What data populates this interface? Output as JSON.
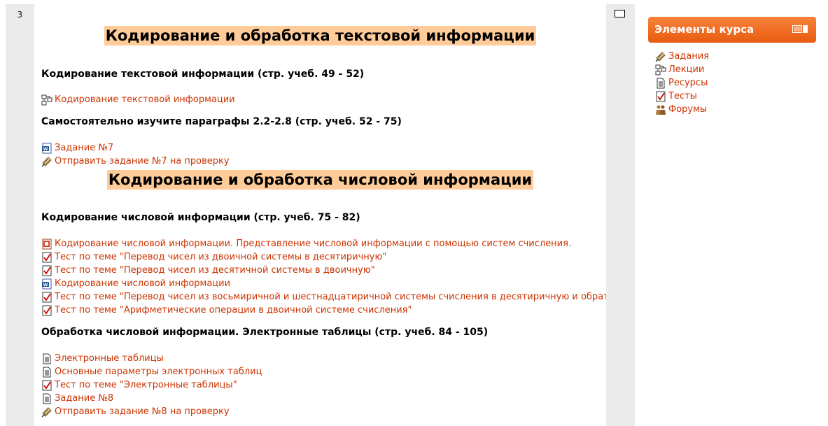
{
  "section": {
    "number": "3"
  },
  "headings": [
    "Кодирование и обработка текстовой информации",
    "Кодирование и обработка числовой информации"
  ],
  "subheads": [
    "Кодирование текстовой информации (стр. учеб. 49 - 52)",
    "Самостоятельно изучите параграфы 2.2-2.8 (стр. учеб. 52 - 75)",
    "Кодирование числовой информации (стр. учеб. 75 - 82)",
    "Обработка числовой информации. Электронные таблицы (стр. учеб. 84 - 105)"
  ],
  "items": [
    {
      "icon": "lesson-icon",
      "label": "Кодирование текстовой информации"
    },
    {
      "icon": "word-doc-icon",
      "label": "Задание №7"
    },
    {
      "icon": "assignment-icon",
      "label": "Отправить задание №7 на проверку"
    },
    {
      "icon": "presentation-icon",
      "label": "Кодирование числовой информации. Представление числовой информации с помощью систем счисления."
    },
    {
      "icon": "quiz-icon",
      "label": "Тест по теме \"Перевод чисел из двоичной системы в десятиричную\""
    },
    {
      "icon": "quiz-icon",
      "label": "Тест по теме \"Перевод чисел из десятичной системы в двоичную\""
    },
    {
      "icon": "word-doc-icon",
      "label": "Кодирование числовой информации"
    },
    {
      "icon": "quiz-icon",
      "label": "Тест по теме \"Перевод чисел из восьмиричной и шестнадцатиричной системы счисления в десятиричную и обратно\""
    },
    {
      "icon": "quiz-icon",
      "label": "Тест по теме \"Арифметические операции в двоичной системе счисления\""
    },
    {
      "icon": "page-icon",
      "label": "Электронные таблицы"
    },
    {
      "icon": "page-icon",
      "label": "Основные параметры электронных таблиц"
    },
    {
      "icon": "quiz-icon",
      "label": "Тест по теме \"Электронные таблицы\""
    },
    {
      "icon": "page-icon",
      "label": "Задание №8"
    },
    {
      "icon": "assignment-icon",
      "label": "Отправить задание №8 на проверку"
    }
  ],
  "block": {
    "title": "Элементы курса",
    "items": [
      {
        "icon": "assignment-icon",
        "label": "Задания"
      },
      {
        "icon": "lesson-icon",
        "label": "Лекции"
      },
      {
        "icon": "page-icon",
        "label": "Ресурсы"
      },
      {
        "icon": "quiz-icon",
        "label": "Тесты"
      },
      {
        "icon": "forum-icon",
        "label": "Форумы"
      }
    ]
  },
  "colors": {
    "link": "#cc3300",
    "heading_highlight": "#ffcc99",
    "block_header": "#f07030"
  }
}
